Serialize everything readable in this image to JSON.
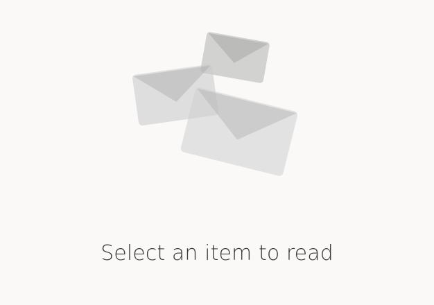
{
  "reading_pane": {
    "empty_message": "Select an item to read",
    "illustration": {
      "icon": "envelopes-icon",
      "envelope_count": 3
    }
  },
  "colors": {
    "background": "#faf9f8",
    "text": "#3b3a39",
    "envelope_body": "#d6d6d6",
    "envelope_flap": "#b8b8b8"
  }
}
